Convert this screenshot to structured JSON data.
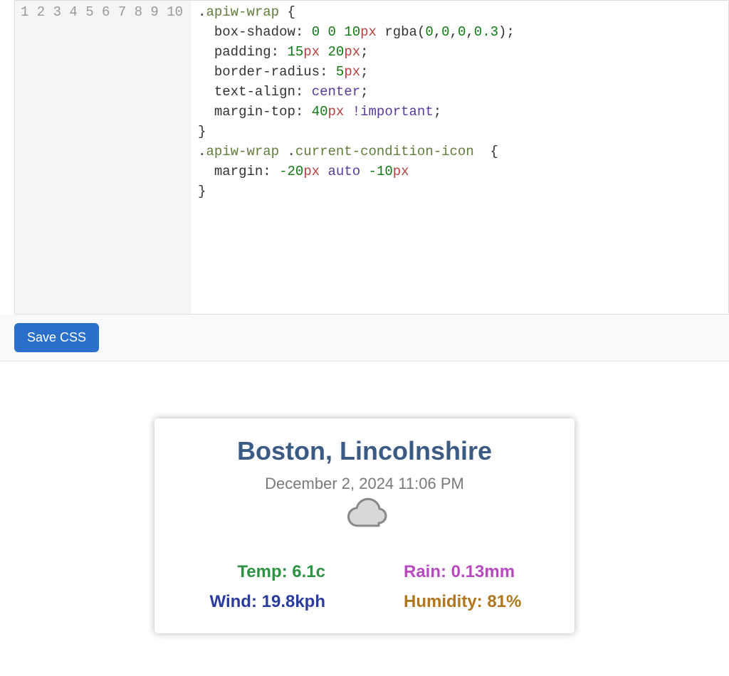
{
  "editor": {
    "line_count": 10,
    "lines": [
      {
        "sel": ".apiw-wrap",
        "open": " {"
      },
      {
        "prop": "box-shadow:",
        "vals": [
          [
            "0",
            "num"
          ],
          [
            " ",
            ""
          ],
          [
            "0",
            "num"
          ],
          [
            " ",
            ""
          ],
          [
            "10",
            "num"
          ],
          [
            "px",
            "unit"
          ],
          [
            " ",
            ""
          ],
          [
            "rgba",
            "func"
          ],
          [
            "(",
            ""
          ],
          [
            "0",
            "num"
          ],
          [
            ",",
            ""
          ],
          [
            "0",
            "num"
          ],
          [
            ",",
            ""
          ],
          [
            "0",
            "num"
          ],
          [
            ",",
            ""
          ],
          [
            "0.3",
            "num"
          ],
          [
            ")",
            ""
          ],
          [
            ";",
            "punct"
          ]
        ]
      },
      {
        "prop": "padding:",
        "vals": [
          [
            "15",
            "num"
          ],
          [
            "px",
            "unit"
          ],
          [
            " ",
            ""
          ],
          [
            "20",
            "num"
          ],
          [
            "px",
            "unit"
          ],
          [
            ";",
            "punct"
          ]
        ]
      },
      {
        "prop": "border-radius:",
        "vals": [
          [
            "5",
            "num"
          ],
          [
            "px",
            "unit"
          ],
          [
            ";",
            "punct"
          ]
        ]
      },
      {
        "prop": "text-align:",
        "vals": [
          [
            "center",
            "kw"
          ],
          [
            ";",
            "punct"
          ]
        ]
      },
      {
        "prop": "margin-top:",
        "vals": [
          [
            "40",
            "num"
          ],
          [
            "px",
            "unit"
          ],
          [
            " ",
            ""
          ],
          [
            "!important",
            "important"
          ],
          [
            ";",
            "punct"
          ]
        ]
      },
      {
        "close": "}"
      },
      {
        "sel": ".apiw-wrap .current-condition-icon",
        "open": "  {"
      },
      {
        "prop": "margin:",
        "vals": [
          [
            "-20",
            "num"
          ],
          [
            "px",
            "unit"
          ],
          [
            " ",
            ""
          ],
          [
            "auto",
            "kw"
          ],
          [
            " ",
            ""
          ],
          [
            "-10",
            "num"
          ],
          [
            "px",
            "unit"
          ]
        ]
      },
      {
        "close": "}"
      }
    ]
  },
  "buttons": {
    "save_css": "Save CSS"
  },
  "weather": {
    "location": "Boston,  Lincolnshire",
    "timestamp": "December 2, 2024 11:06 PM",
    "icon": "cloud-icon",
    "temp_label": "Temp: 6.1c",
    "rain_label": "Rain: 0.13mm",
    "wind_label": "Wind: 19.8kph",
    "humidity_label": "Humidity: 81%"
  }
}
